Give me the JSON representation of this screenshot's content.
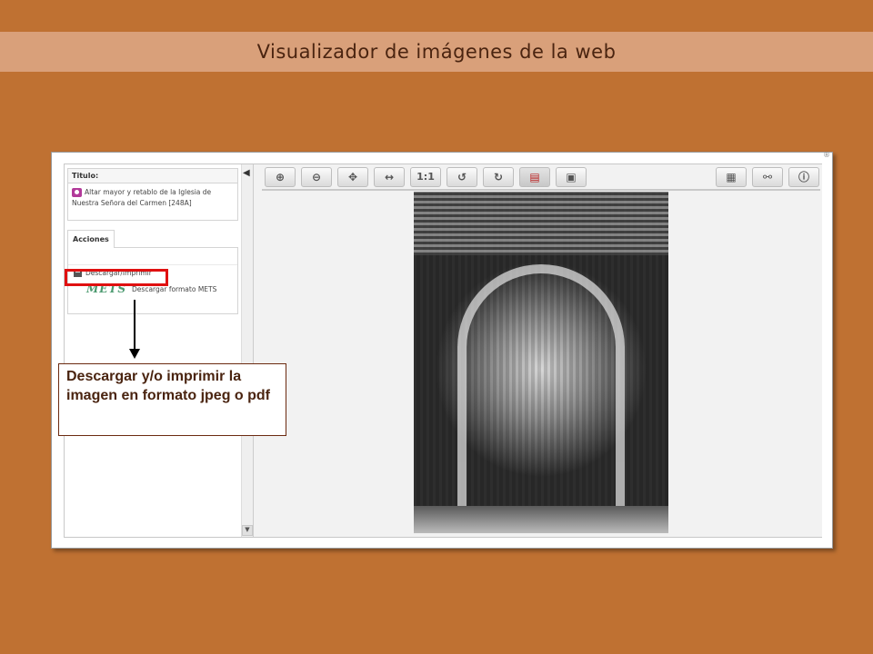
{
  "slide": {
    "title": "Visualizador de imágenes de la web"
  },
  "viewer": {
    "corner_mark": "®",
    "left_panel": {
      "title_header": "Titulo:",
      "title_line1": "Altar mayor y retablo de la Iglesia de",
      "title_line2": "Nuestra Señora del Carmen [248A]",
      "tab_label": "Acciones",
      "action_download": "Descargar/Imprimir",
      "mets_logo": "METS",
      "action_mets": "Descargar formato METS"
    },
    "collapse_glyph": "◀",
    "scroll_down_glyph": "▼",
    "toolbar": {
      "buttons": [
        {
          "name": "zoom-in-icon",
          "glyph": "⊕"
        },
        {
          "name": "zoom-out-icon",
          "glyph": "⊖"
        },
        {
          "name": "fit-icon",
          "glyph": "✥"
        },
        {
          "name": "fit-width-icon",
          "glyph": "↔"
        },
        {
          "name": "actual-size-icon",
          "glyph": "1:1"
        },
        {
          "name": "rotate-left-icon",
          "glyph": "↺"
        },
        {
          "name": "rotate-right-icon",
          "glyph": "↻"
        },
        {
          "name": "pdf-icon",
          "glyph": "▤"
        },
        {
          "name": "save-icon",
          "glyph": "▣"
        },
        {
          "name": "grid-icon",
          "glyph": "▦"
        },
        {
          "name": "link-icon",
          "glyph": "⚯"
        },
        {
          "name": "info-icon",
          "glyph": "ⓘ"
        }
      ]
    }
  },
  "callout": {
    "text": "Descargar y/o imprimir la imagen en formato jpeg o pdf"
  }
}
